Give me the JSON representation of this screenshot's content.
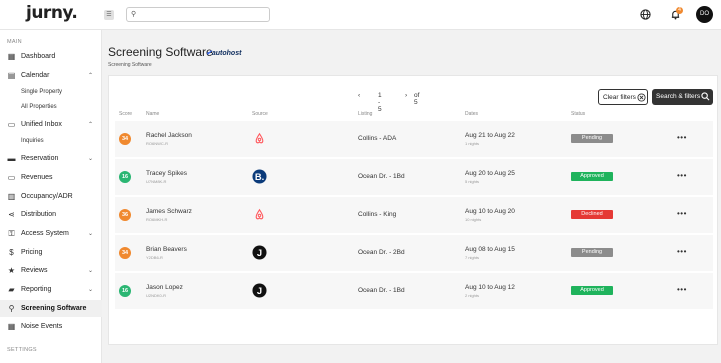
{
  "app": {
    "logo": "jurny."
  },
  "topbar": {
    "search_placeholder": "",
    "notification_count": "4",
    "avatar_initials": "DO"
  },
  "sidebar": {
    "section_main": "MAIN",
    "section_settings": "SETTINGS",
    "items": [
      {
        "label": "Dashboard",
        "icon": "dashboard-icon"
      },
      {
        "label": "Calendar",
        "icon": "calendar-icon",
        "sub": [
          "Single Property",
          "All Properties"
        ]
      },
      {
        "label": "Unified Inbox",
        "icon": "inbox-icon",
        "sub": [
          "Inquiries"
        ]
      },
      {
        "label": "Reservation",
        "icon": "reservation-icon"
      },
      {
        "label": "Revenues",
        "icon": "revenues-icon"
      },
      {
        "label": "Occupancy/ADR",
        "icon": "occupancy-icon"
      },
      {
        "label": "Distribution",
        "icon": "distribution-icon"
      },
      {
        "label": "Access System",
        "icon": "access-icon"
      },
      {
        "label": "Pricing",
        "icon": "pricing-icon"
      },
      {
        "label": "Reviews",
        "icon": "star-icon"
      },
      {
        "label": "Reporting",
        "icon": "reporting-icon"
      },
      {
        "label": "Screening Software",
        "icon": "search-icon",
        "active": true
      },
      {
        "label": "Noise Events",
        "icon": "noise-icon"
      }
    ]
  },
  "page": {
    "title": "Screening Software",
    "brand": "autohost",
    "breadcrumb": "Screening Software"
  },
  "pager": {
    "range": "1 - 5",
    "total": "of 5"
  },
  "buttons": {
    "clear": "Clear filters",
    "search": "Search & filters"
  },
  "columns": {
    "score": "Score",
    "name": "Name",
    "source": "Source",
    "listing": "Listing",
    "dates": "Dates",
    "status": "Status"
  },
  "rows": [
    {
      "score": "34",
      "score_color": "#f0892f",
      "name": "Rachel Jackson",
      "code": "RO6NWC-R",
      "source": "airbnb-icon",
      "listing": "Collins - ADA",
      "dates": "Aug 21 to Aug 22",
      "nights": "1 nights",
      "status": "Pending",
      "status_color": "#8c8c8c"
    },
    {
      "score": "16",
      "score_color": "#2bb673",
      "name": "Tracey Spikes",
      "code": "U7NM8K-R",
      "source": "booking-icon",
      "listing": "Ocean Dr. - 1Bd",
      "dates": "Aug 20 to Aug 25",
      "nights": "5 nights",
      "status": "Approved",
      "status_color": "#1fb35c"
    },
    {
      "score": "36",
      "score_color": "#f0892f",
      "name": "James Schwarz",
      "code": "RO6MKH-R",
      "source": "airbnb-icon",
      "listing": "Collins - King",
      "dates": "Aug 10 to Aug 20",
      "nights": "10 nights",
      "status": "Declined",
      "status_color": "#e53935"
    },
    {
      "score": "34",
      "score_color": "#f0892f",
      "name": "Brian Beavers",
      "code": "Y2DB6-R",
      "source": "direct-icon",
      "listing": "Ocean Dr. - 2Bd",
      "dates": "Aug 08 to Aug 15",
      "nights": "7 nights",
      "status": "Pending",
      "status_color": "#8c8c8c"
    },
    {
      "score": "16",
      "score_color": "#2bb673",
      "name": "Jason Lopez",
      "code": "U2NDK0-R",
      "source": "direct-icon",
      "listing": "Ocean Dr. - 1Bd",
      "dates": "Aug 10 to Aug 12",
      "nights": "2 nights",
      "status": "Approved",
      "status_color": "#1fb35c"
    }
  ]
}
